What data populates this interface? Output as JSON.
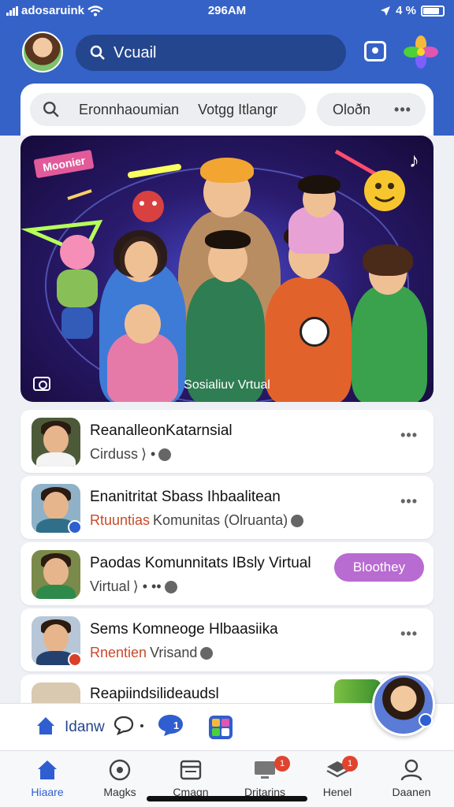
{
  "status_bar": {
    "carrier": "adosaruink",
    "time": "296AM",
    "battery": "4 %"
  },
  "header": {
    "search_placeholder": "Vcuail"
  },
  "filters": {
    "tab_1": "Eronnhaoumian",
    "tab_2": "Votgg Itlangr",
    "tab_3": "Oloðn",
    "more": "•••"
  },
  "banner": {
    "tag": "Moonier",
    "caption": "Sosialiuv Vrtual"
  },
  "feed": [
    {
      "title": "ReanalleonKatarnsial",
      "subtitle": "Cirduss",
      "subtitle_tail": "⟩ •",
      "more": "•••"
    },
    {
      "title": "Enanitritat Sbass Ihbaalitean",
      "subtitle": "Rtuuntias",
      "subtitle_tail": "Komunitas (Olruanta)",
      "more": "•••"
    },
    {
      "title": "Paodas Komunnitats IBsly Virtual",
      "subtitle": "Virtual",
      "subtitle_tail": "⟩ • ••",
      "button": "Bloothey"
    },
    {
      "title": "Sems Komneoge Hlbaasiika",
      "subtitle": "Rnentien",
      "subtitle_tail": "Vrisand",
      "more": "•••"
    },
    {
      "title": "Reapiindsilideaudsl"
    }
  ],
  "compose_bar": {
    "label": "Idanw"
  },
  "bottom_nav": [
    {
      "label": "Hiaare",
      "badge": ""
    },
    {
      "label": "Magks",
      "badge": ""
    },
    {
      "label": "Cmagn",
      "badge": ""
    },
    {
      "label": "Dritarins",
      "badge": "1"
    },
    {
      "label": "Henel",
      "badge": "1"
    },
    {
      "label": "Daanen",
      "badge": ""
    }
  ],
  "colors": {
    "header_blue": "#3562c7",
    "search_blue": "#24468f",
    "accent_purple": "#b86bd0",
    "active_tab": "#2f5ed0"
  }
}
